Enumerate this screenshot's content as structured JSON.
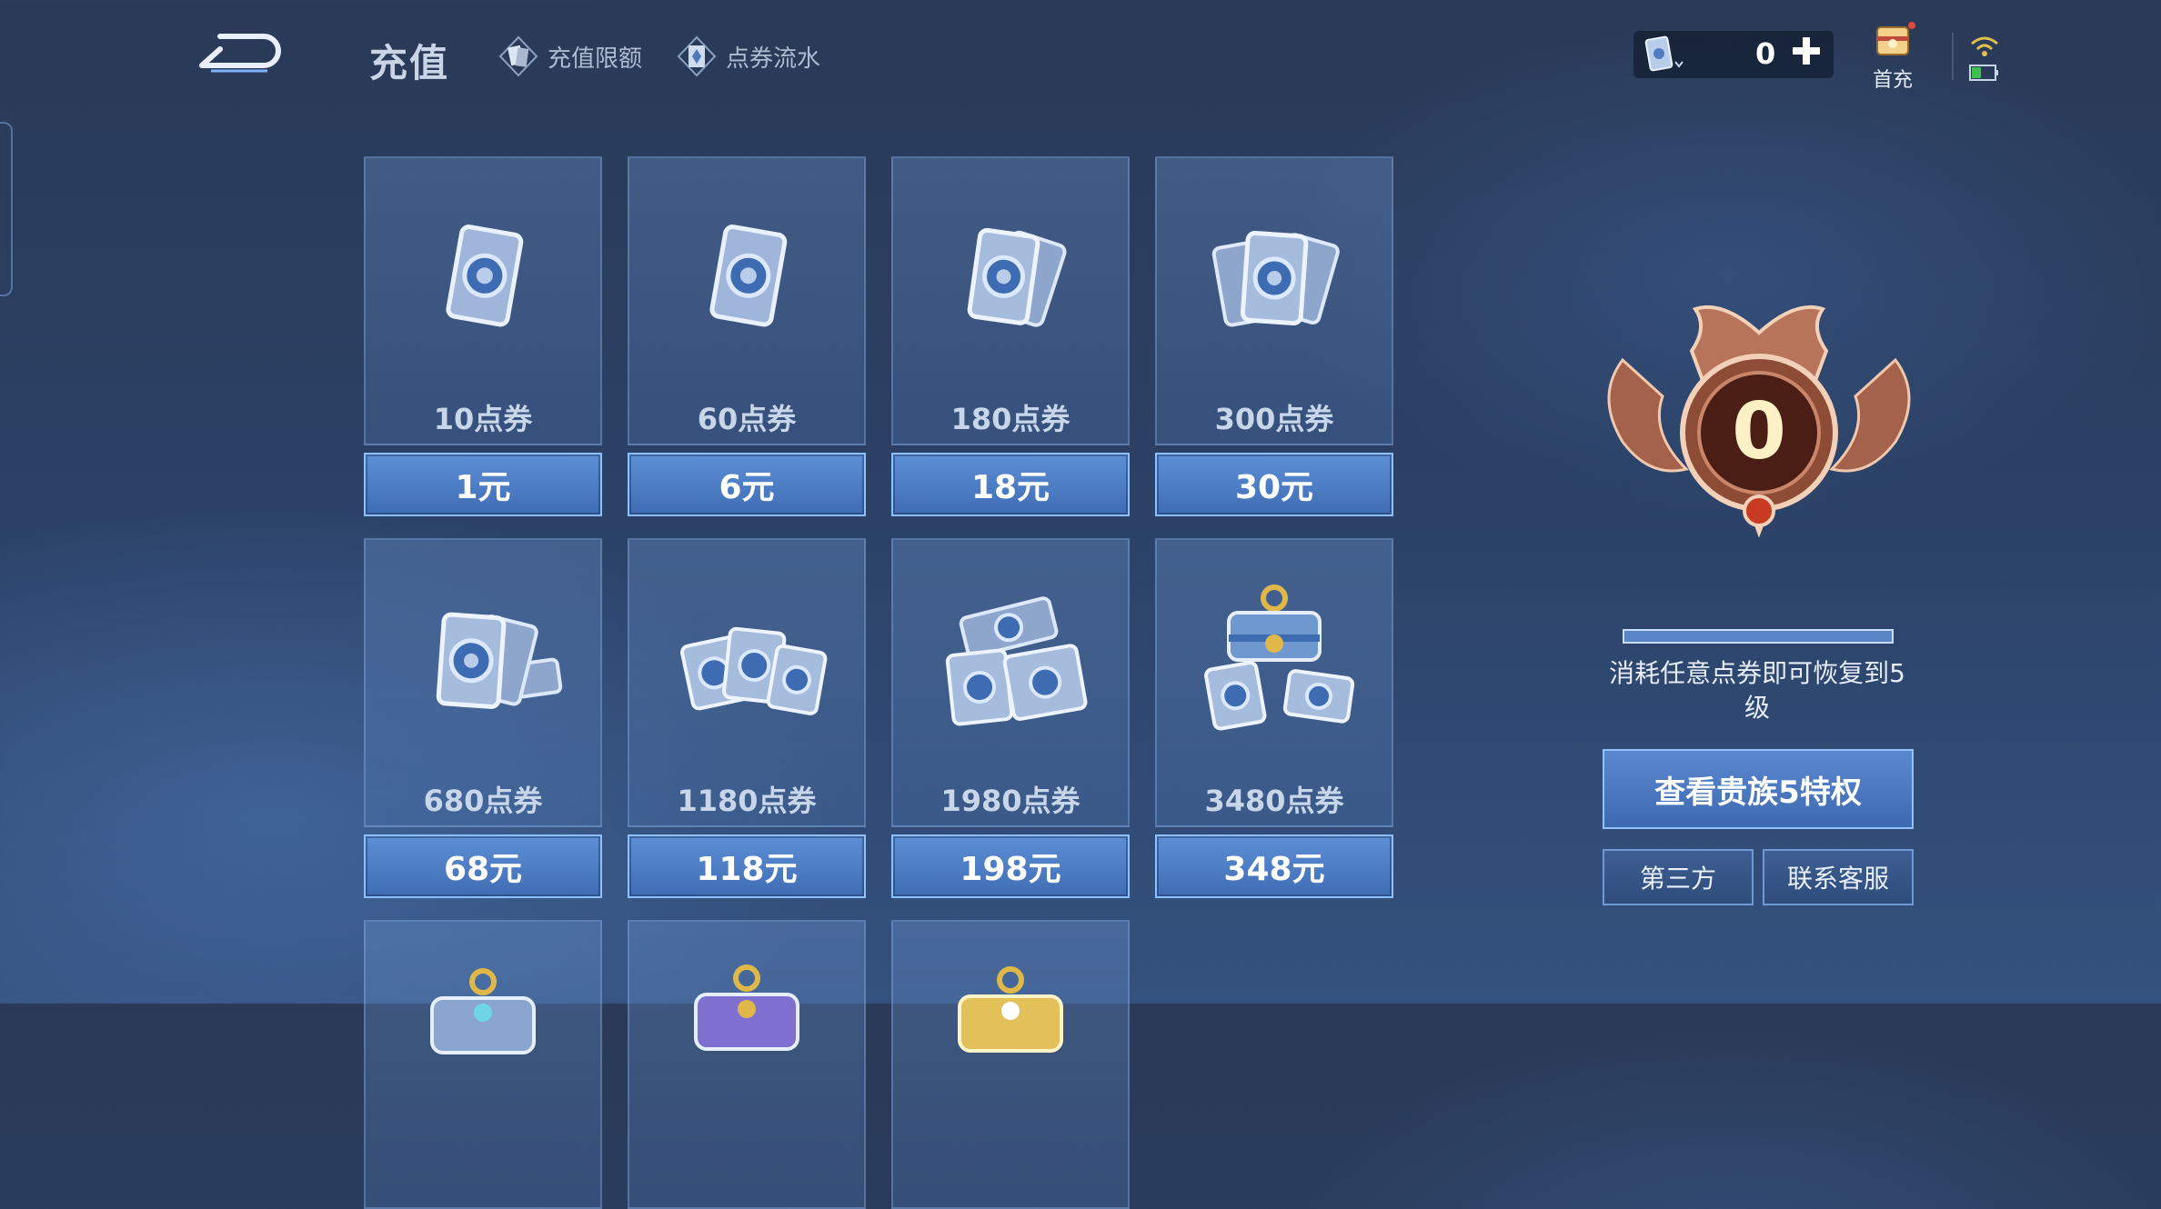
{
  "header": {
    "title": "充值",
    "links": [
      {
        "label": "充值限额",
        "icon": "card-limit-icon"
      },
      {
        "label": "点券流水",
        "icon": "coupon-flow-icon"
      }
    ]
  },
  "currency": {
    "value": "0",
    "icon": "coupon-icon"
  },
  "first_charge": {
    "label": "首充"
  },
  "packages": [
    {
      "points": "10点券",
      "price": "1元"
    },
    {
      "points": "60点券",
      "price": "6元"
    },
    {
      "points": "180点券",
      "price": "18元"
    },
    {
      "points": "300点券",
      "price": "30元"
    },
    {
      "points": "680点券",
      "price": "68元"
    },
    {
      "points": "1180点券",
      "price": "118元"
    },
    {
      "points": "1980点券",
      "price": "198元"
    },
    {
      "points": "3480点券",
      "price": "348元"
    }
  ],
  "noble": {
    "level": "0",
    "description": "消耗任意点券即可恢复到5级",
    "progress": 0,
    "view_button": "查看贵族5特权",
    "third_party": "第三方",
    "customer_service": "联系客服"
  },
  "colors": {
    "accent": "#5b8ed6",
    "border": "#8cc0ff",
    "bronze": "#b06a4e"
  }
}
